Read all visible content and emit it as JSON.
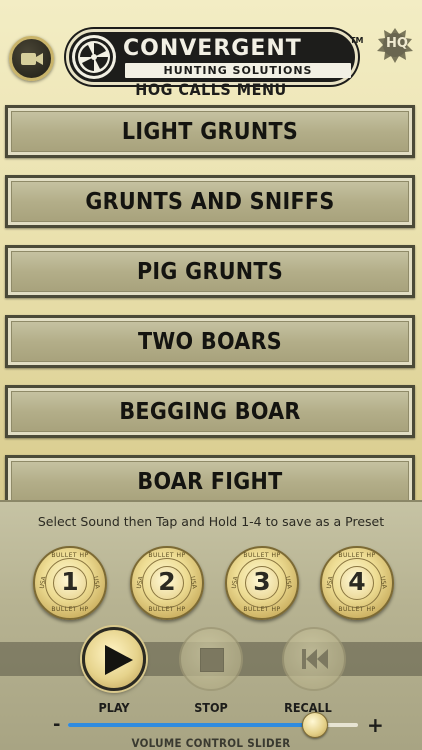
{
  "header": {
    "logo_top": "CONVERGENT",
    "logo_sub": "HUNTING SOLUTIONS",
    "trademark": "TM",
    "hq_badge": "HQ",
    "menu_title": "HOG CALLS MENU"
  },
  "menu": {
    "items": [
      {
        "label": "LIGHT GRUNTS"
      },
      {
        "label": "GRUNTS AND SNIFFS"
      },
      {
        "label": "PIG GRUNTS"
      },
      {
        "label": "TWO BOARS"
      },
      {
        "label": "BEGGING BOAR"
      },
      {
        "label": "BOAR FIGHT"
      }
    ]
  },
  "panel": {
    "instruction": "Select Sound then Tap and Hold 1-4 to save as a Preset",
    "presets": [
      {
        "number": "1",
        "text_top": "BULLET HP",
        "text_bottom": "BULLET HP",
        "text_left": "USA",
        "text_right": "USA"
      },
      {
        "number": "2",
        "text_top": "BULLET HP",
        "text_bottom": "BULLET HP",
        "text_left": "USA",
        "text_right": "USA"
      },
      {
        "number": "3",
        "text_top": "BULLET HP",
        "text_bottom": "BULLET HP",
        "text_left": "USA",
        "text_right": "USA"
      },
      {
        "number": "4",
        "text_top": "BULLET HP",
        "text_bottom": "BULLET HP",
        "text_left": "USA",
        "text_right": "USA"
      }
    ],
    "controls": {
      "play_label": "PLAY",
      "stop_label": "STOP",
      "recall_label": "RECALL"
    },
    "volume": {
      "label": "VOLUME CONTROL SLIDER",
      "minus": "-",
      "plus": "+",
      "level": 0.85
    }
  },
  "colors": {
    "accent": "#2f8be0",
    "button_border": "#4b4a38",
    "text_dark": "#141410"
  }
}
